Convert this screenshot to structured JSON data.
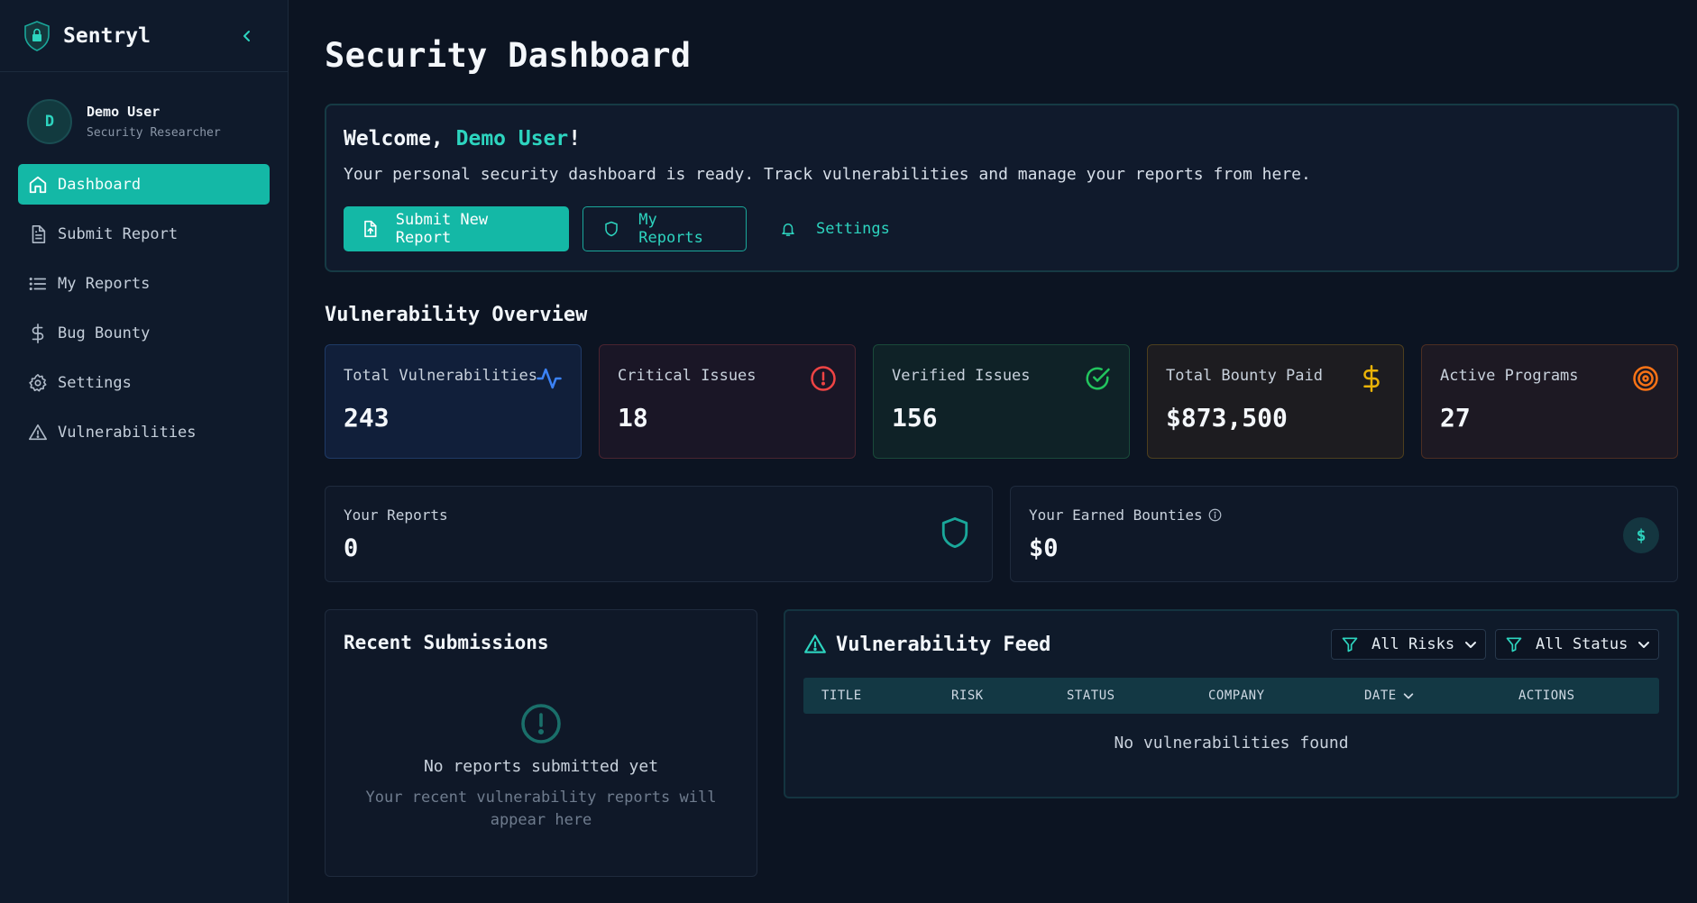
{
  "sidebar": {
    "brand": "Sentryl",
    "user": {
      "initial": "D",
      "name": "Demo User",
      "role": "Security Researcher"
    },
    "nav": [
      {
        "label": "Dashboard",
        "icon": "home-icon",
        "active": true
      },
      {
        "label": "Submit Report",
        "icon": "document-icon"
      },
      {
        "label": "My Reports",
        "icon": "list-icon"
      },
      {
        "label": "Bug Bounty",
        "icon": "dollar-icon"
      },
      {
        "label": "Settings",
        "icon": "gear-icon"
      },
      {
        "label": "Vulnerabilities",
        "icon": "warning-icon"
      }
    ]
  },
  "page": {
    "title": "Security Dashboard"
  },
  "welcome": {
    "greeting_prefix": "Welcome, ",
    "name": "Demo User",
    "greeting_suffix": "!",
    "subtitle": "Your personal security dashboard is ready. Track vulnerabilities and manage your reports from here.",
    "buttons": {
      "submit": "Submit New Report",
      "reports": "My Reports",
      "settings": "Settings"
    }
  },
  "overview": {
    "title": "Vulnerability Overview",
    "stats": [
      {
        "label": "Total Vulnerabilities",
        "value": "243",
        "icon": "activity-icon",
        "color": "#3b82f6"
      },
      {
        "label": "Critical Issues",
        "value": "18",
        "icon": "alert-circle-icon",
        "color": "#ef4444"
      },
      {
        "label": "Verified Issues",
        "value": "156",
        "icon": "check-circle-icon",
        "color": "#22c55e"
      },
      {
        "label": "Total Bounty Paid",
        "value": "$873,500",
        "icon": "dollar-icon",
        "color": "#eab308"
      },
      {
        "label": "Active Programs",
        "value": "27",
        "icon": "target-icon",
        "color": "#f97316"
      }
    ]
  },
  "personal": {
    "reports": {
      "label": "Your Reports",
      "value": "0"
    },
    "bounties": {
      "label": "Your Earned Bounties",
      "value": "$0",
      "badge": "$"
    }
  },
  "recent": {
    "title": "Recent Submissions",
    "empty_title": "No reports submitted yet",
    "empty_sub": "Your recent vulnerability reports will appear here"
  },
  "feed": {
    "title": "Vulnerability Feed",
    "filters": {
      "risk": "All Risks",
      "status": "All Status"
    },
    "columns": [
      "TITLE",
      "RISK",
      "STATUS",
      "COMPANY",
      "DATE",
      "ACTIONS"
    ],
    "empty": "No vulnerabilities found"
  },
  "colors": {
    "accent": "#14b8a6",
    "accent_text": "#2dd4bf",
    "background": "#0c1422",
    "sidebar": "#0f1a2b"
  }
}
